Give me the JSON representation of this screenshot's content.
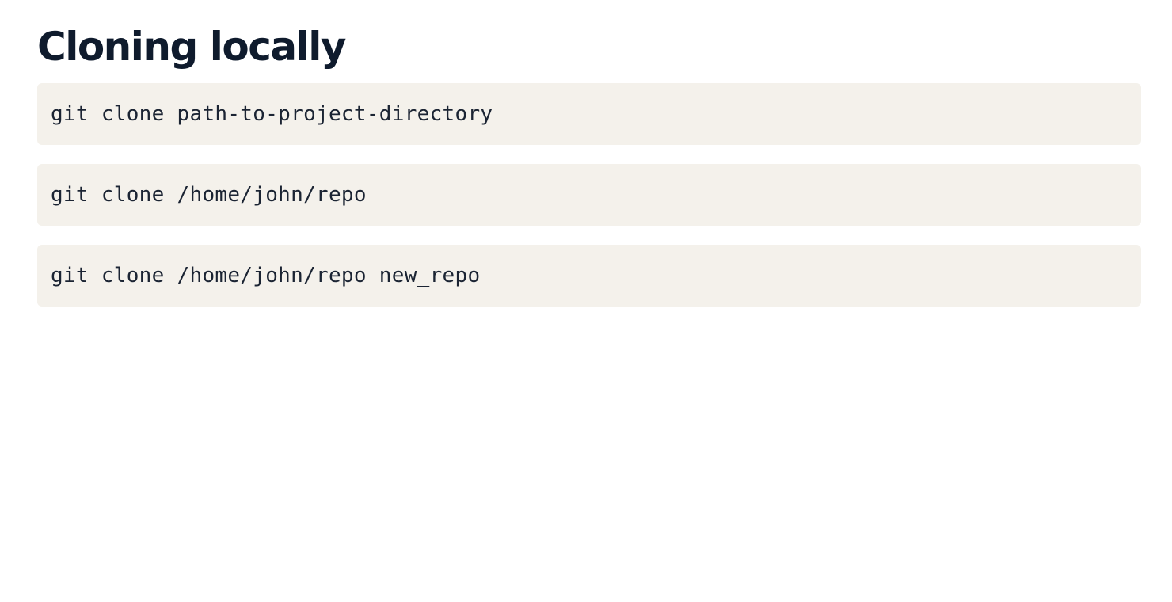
{
  "page": {
    "title": "Cloning locally"
  },
  "code_blocks": [
    {
      "code": "git clone path-to-project-directory"
    },
    {
      "code": "git clone /home/john/repo"
    },
    {
      "code": "git clone /home/john/repo new_repo"
    }
  ],
  "colors": {
    "title": "#0f1b2d",
    "code_background": "#f4f1eb",
    "code_text": "#1b2433",
    "page_background": "#ffffff"
  }
}
